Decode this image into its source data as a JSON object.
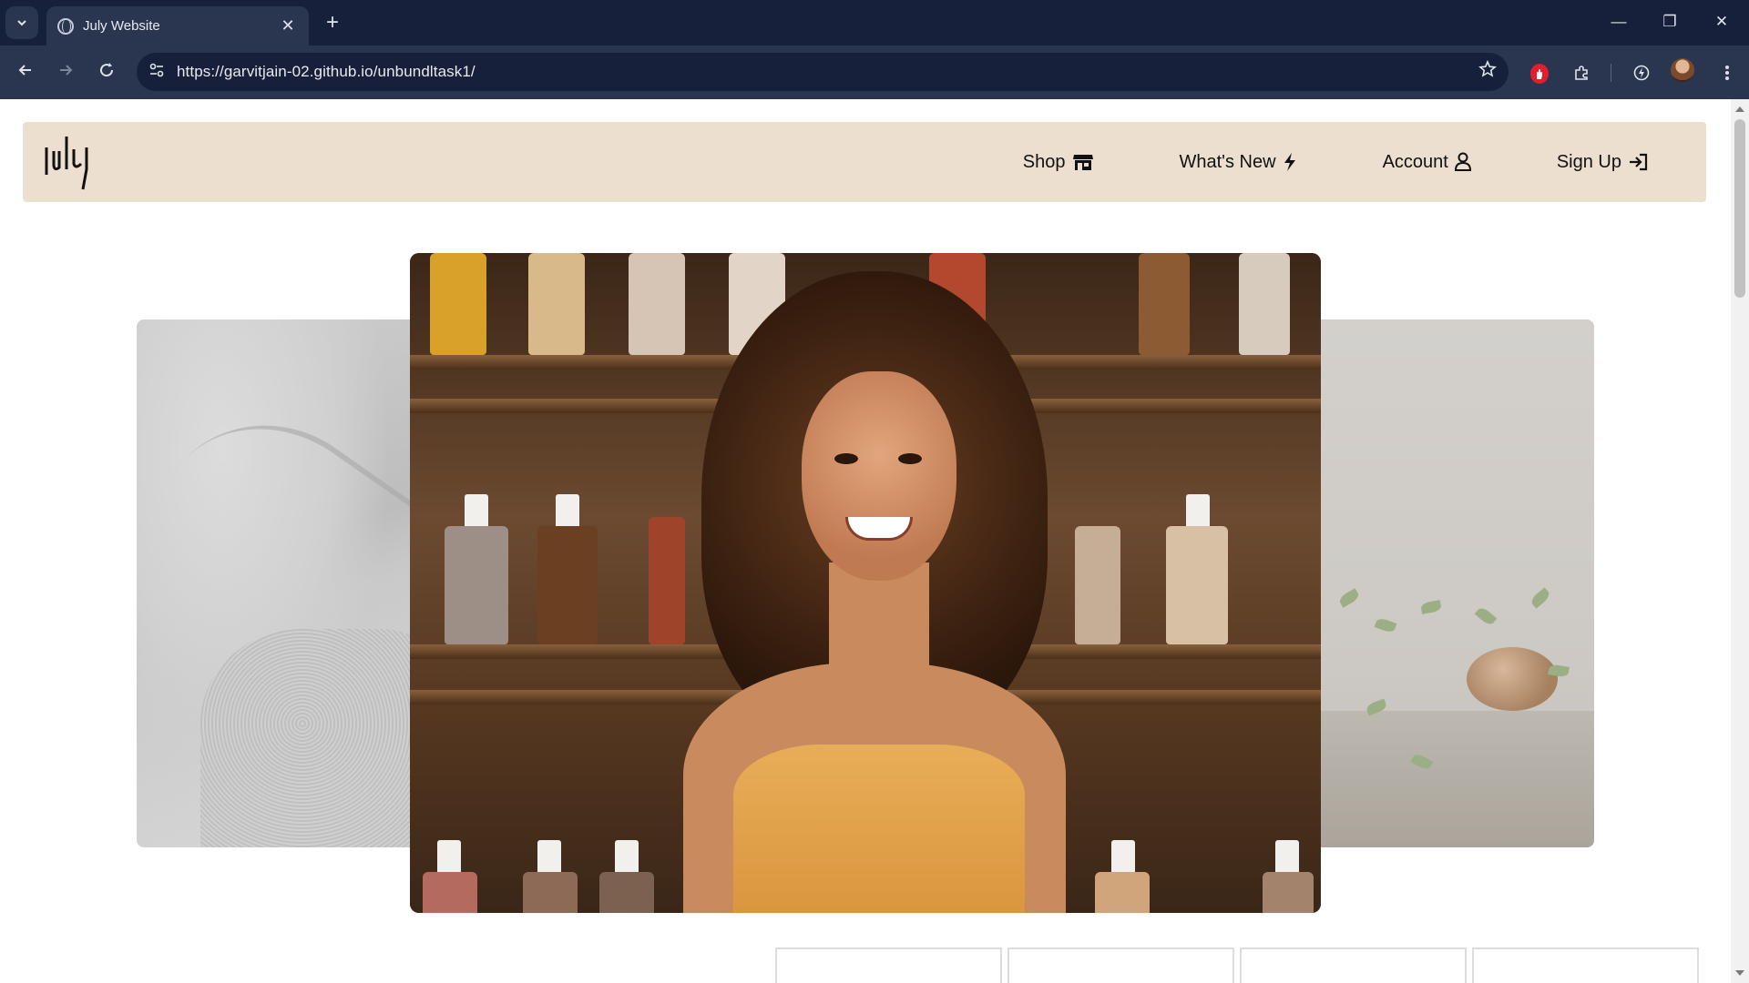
{
  "browser": {
    "tab_title": "July Website",
    "url": "https://garvitjain-02.github.io/unbundltask1/",
    "new_tab_symbol": "+",
    "close_tab_symbol": "✕",
    "window_controls": {
      "minimize": "—",
      "restore": "❐",
      "close": "✕"
    }
  },
  "site": {
    "brand": "july",
    "nav": [
      {
        "label": "Shop",
        "icon": "store-icon"
      },
      {
        "label": "What's New",
        "icon": "lightning-icon"
      },
      {
        "label": "Account",
        "icon": "user-icon"
      },
      {
        "label": "Sign Up",
        "icon": "sign-in-icon"
      }
    ]
  },
  "carousel": {
    "slides": [
      {
        "position": "left",
        "description_icon": "stone-texture-image"
      },
      {
        "position": "center",
        "description_icon": "woman-with-bottles-image"
      },
      {
        "position": "right",
        "description_icon": "plant-still-life-image"
      }
    ],
    "thumbnail_count": 4
  }
}
